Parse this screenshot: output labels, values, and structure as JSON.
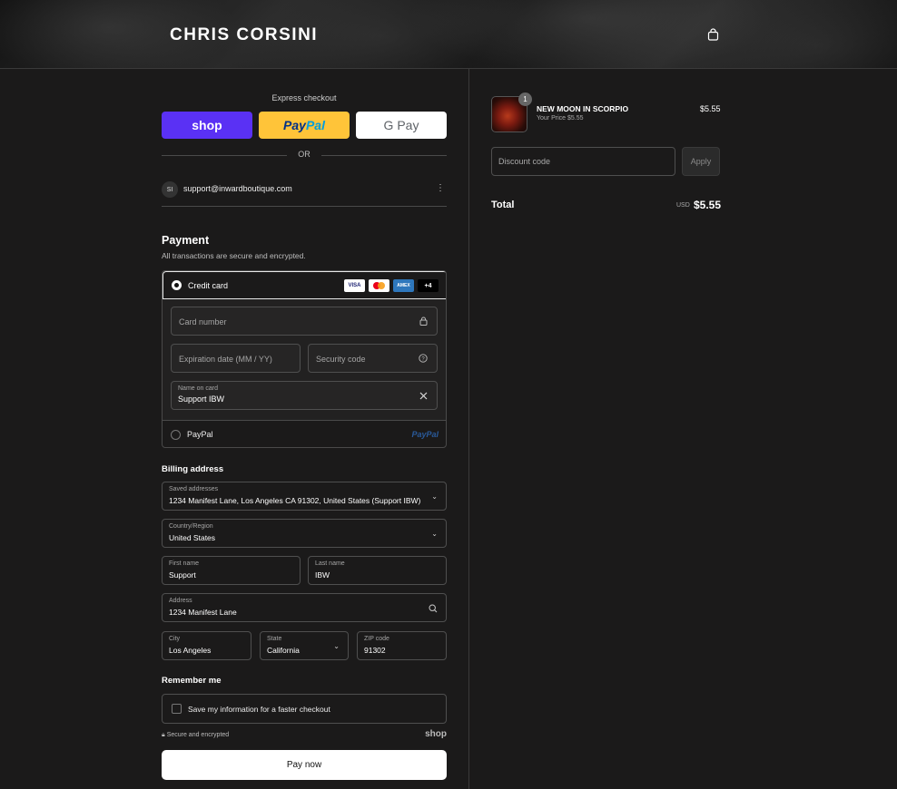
{
  "header": {
    "brand": "CHRIS CORSINI",
    "cart_icon": "shopping-bag-icon"
  },
  "express": {
    "label": "Express checkout",
    "shop": "shop",
    "paypal_a": "Pay",
    "paypal_b": "Pal",
    "gpay": "G Pay",
    "or": "OR"
  },
  "account": {
    "initials": "SI",
    "email": "support@inwardboutique.com",
    "menu": "⋮"
  },
  "payment": {
    "title": "Payment",
    "subtitle": "All transactions are secure and encrypted.",
    "credit_card_label": "Credit card",
    "card_logos": {
      "visa": "VISA",
      "amex": "AMEX",
      "more": "+4"
    },
    "card_number_placeholder": "Card number",
    "expiration_placeholder": "Expiration date (MM / YY)",
    "security_placeholder": "Security code",
    "name_label": "Name on card",
    "name_value": "Support IBW",
    "paypal_label": "PayPal",
    "paypal_logo": "PayPal"
  },
  "billing": {
    "title": "Billing address",
    "saved_label": "Saved addresses",
    "saved_value": "1234 Manifest Lane, Los Angeles CA 91302, United States (Support IBW)",
    "country_label": "Country/Region",
    "country_value": "United States",
    "first_label": "First name",
    "first_value": "Support",
    "last_label": "Last name",
    "last_value": "IBW",
    "address_label": "Address",
    "address_value": "1234 Manifest Lane",
    "city_label": "City",
    "city_value": "Los Angeles",
    "state_label": "State",
    "state_value": "California",
    "zip_label": "ZIP code",
    "zip_value": "91302"
  },
  "remember": {
    "title": "Remember me",
    "save_label": "Save my information for a faster checkout",
    "secure": "Secure and encrypted",
    "shop": "shop"
  },
  "pay_button": "Pay now",
  "summary": {
    "qty": "1",
    "product_name": "NEW MOON IN SCORPIO",
    "your_price": "Your Price $5.55",
    "price": "$5.55",
    "discount_placeholder": "Discount code",
    "apply": "Apply",
    "total_label": "Total",
    "currency": "USD",
    "total": "$5.55"
  }
}
